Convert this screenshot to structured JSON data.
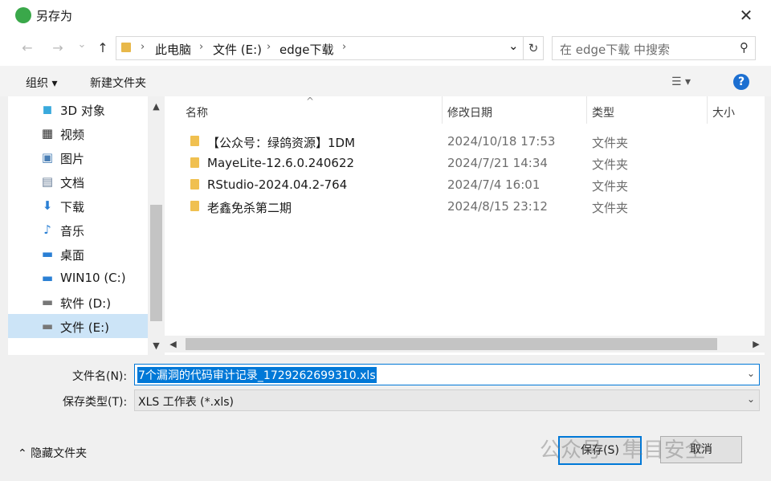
{
  "window": {
    "title": "另存为",
    "close_glyph": "✕"
  },
  "nav": {
    "back_icon": "←",
    "forward_icon": "→",
    "recent_icon": "⌄",
    "up_icon": "↑",
    "breadcrumb": [
      "此电脑",
      "文件 (E:)",
      "edge下载"
    ],
    "sep": "›",
    "dropdown_icon": "⌄",
    "refresh_icon": "↻",
    "search_placeholder": "在 edge下载 中搜索",
    "search_icon": "⚲"
  },
  "toolbar": {
    "organize": "组织 ▾",
    "new_folder": "新建文件夹",
    "view_icon": "☰ ▾",
    "help": "?"
  },
  "sidebar": {
    "items": [
      {
        "label": "3D 对象",
        "icon": "cube-icon",
        "glyph": "◼",
        "color": "#39a9dc"
      },
      {
        "label": "视频",
        "icon": "video-icon",
        "glyph": "▦",
        "color": "#2d2d2d"
      },
      {
        "label": "图片",
        "icon": "pictures-icon",
        "glyph": "▣",
        "color": "#4a7fb5"
      },
      {
        "label": "文档",
        "icon": "documents-icon",
        "glyph": "▤",
        "color": "#6b7f99"
      },
      {
        "label": "下载",
        "icon": "download-icon",
        "glyph": "⬇",
        "color": "#2a7fd4"
      },
      {
        "label": "音乐",
        "icon": "music-icon",
        "glyph": "♪",
        "color": "#2a7fd4"
      },
      {
        "label": "桌面",
        "icon": "desktop-icon",
        "glyph": "▬",
        "color": "#2a7fd4"
      },
      {
        "label": "WIN10 (C:)",
        "icon": "drive-c-icon",
        "glyph": "▬",
        "color": "#2a7fd4"
      },
      {
        "label": "软件 (D:)",
        "icon": "drive-d-icon",
        "glyph": "▬",
        "color": "#777777"
      },
      {
        "label": "文件 (E:)",
        "icon": "drive-e-icon",
        "glyph": "▬",
        "color": "#777777",
        "selected": true
      }
    ]
  },
  "filelist": {
    "columns": {
      "name": "名称",
      "modified": "修改日期",
      "type": "类型",
      "size": "大小"
    },
    "sort_glyph": "^",
    "rows": [
      {
        "name": "【公众号：绿鸽资源】1DM",
        "modified": "2024/10/18 17:53",
        "type": "文件夹"
      },
      {
        "name": "MayeLite-12.6.0.240622",
        "modified": "2024/7/21 14:34",
        "type": "文件夹"
      },
      {
        "name": "RStudio-2024.04.2-764",
        "modified": "2024/7/4 16:01",
        "type": "文件夹"
      },
      {
        "name": "老鑫免杀第二期",
        "modified": "2024/8/15 23:12",
        "type": "文件夹"
      }
    ]
  },
  "scroll": {
    "up": "▲",
    "down": "▼",
    "left": "◀",
    "right": "▶"
  },
  "form": {
    "filename_label": "文件名(N):",
    "filename_value": "7个漏洞的代码审计记录_1729262699310.xls",
    "filetype_label": "保存类型(T):",
    "filetype_value": "XLS 工作表 (*.xls)",
    "dropdown_icon": "⌄"
  },
  "footer": {
    "hide_folders": "⌃  隐藏文件夹",
    "save": "保存(S)",
    "cancel": "取消",
    "watermark": "公众号 · 隼目安全"
  },
  "colors": {
    "accent": "#0078d7",
    "selection": "#cce4f7",
    "folder": "#f0c050"
  }
}
